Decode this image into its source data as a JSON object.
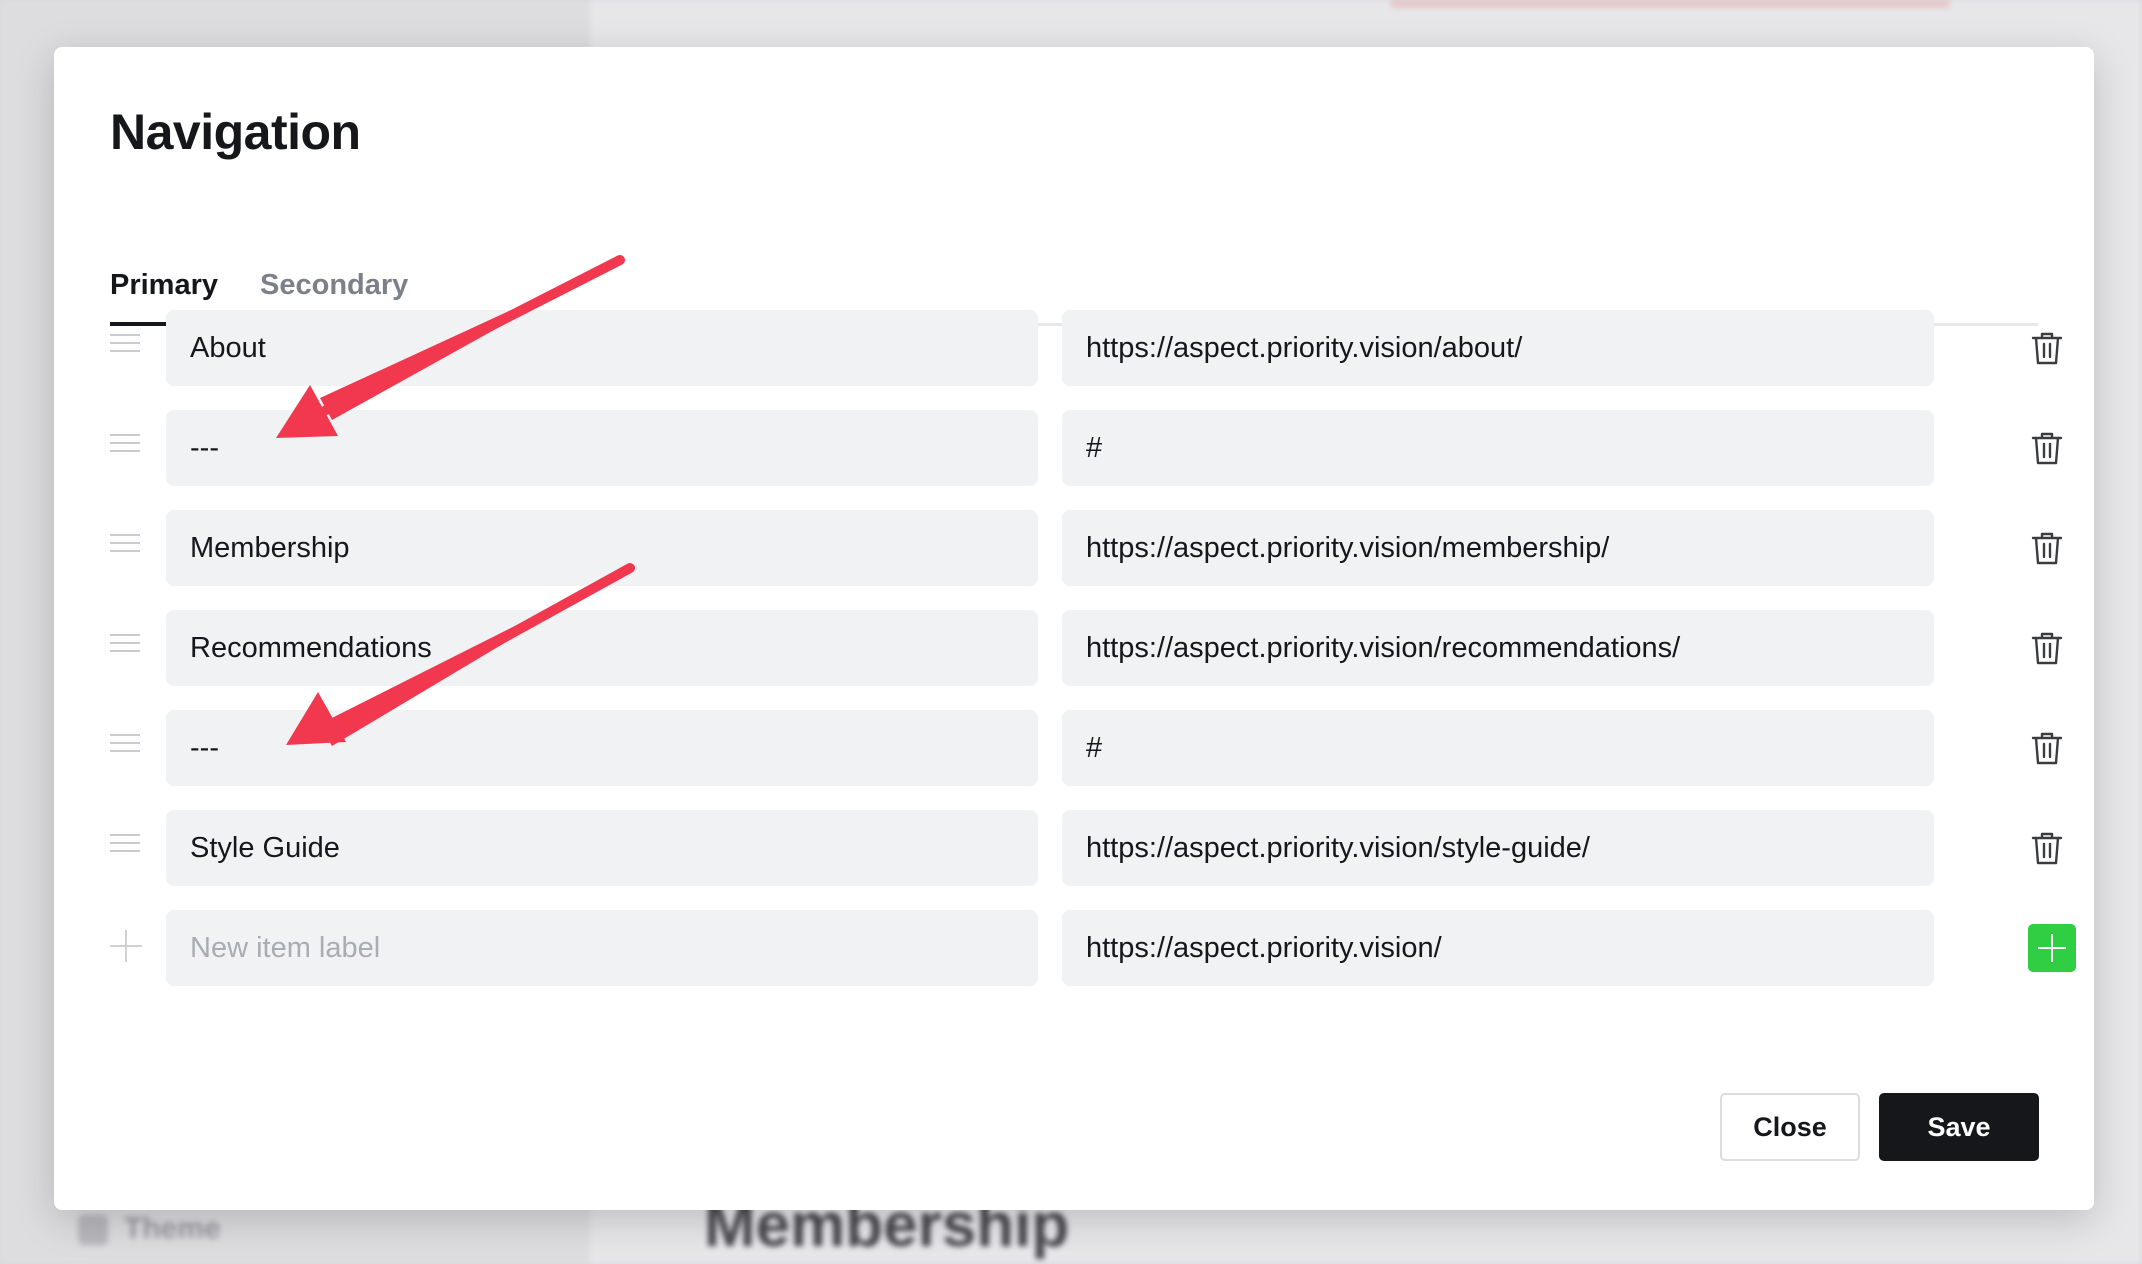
{
  "background": {
    "sidebar_item": "Theme",
    "page_heading": "Membership"
  },
  "modal": {
    "title": "Navigation",
    "tabs": [
      {
        "label": "Primary",
        "active": true
      },
      {
        "label": "Secondary",
        "active": false
      }
    ],
    "items": [
      {
        "label": "About",
        "url": "https://aspect.priority.vision/about/"
      },
      {
        "label": "---",
        "url": "#"
      },
      {
        "label": "Membership",
        "url": "https://aspect.priority.vision/membership/"
      },
      {
        "label": "Recommendations",
        "url": "https://aspect.priority.vision/recommendations/"
      },
      {
        "label": "---",
        "url": "#"
      },
      {
        "label": "Style Guide",
        "url": "https://aspect.priority.vision/style-guide/"
      }
    ],
    "new_item": {
      "label_placeholder": "New item label",
      "url": "https://aspect.priority.vision/"
    },
    "buttons": {
      "close": "Close",
      "save": "Save"
    }
  },
  "icons": {
    "drag": "drag-handle-icon",
    "delete": "trash-icon",
    "add": "plus-icon"
  },
  "colors": {
    "add_button": "#30cf43",
    "save_button": "#15171a",
    "annotation_arrow": "#f2384f"
  }
}
